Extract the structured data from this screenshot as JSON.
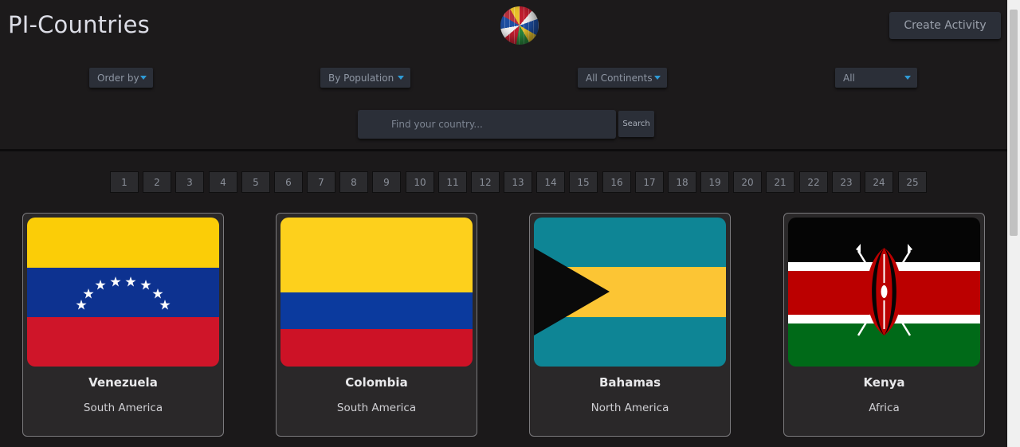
{
  "header": {
    "title": "PI-Countries",
    "create_button": "Create Activity"
  },
  "filters": {
    "order_by": "Order by",
    "population": "By Population",
    "continents": "All Continents",
    "activities": "All"
  },
  "search": {
    "placeholder": "Find your country...",
    "button": "Search"
  },
  "pagination": [
    "1",
    "2",
    "3",
    "4",
    "5",
    "6",
    "7",
    "8",
    "9",
    "10",
    "11",
    "12",
    "13",
    "14",
    "15",
    "16",
    "17",
    "18",
    "19",
    "20",
    "21",
    "22",
    "23",
    "24",
    "25"
  ],
  "countries": [
    {
      "name": "Venezuela",
      "continent": "South America",
      "flag": "venezuela-flag-icon"
    },
    {
      "name": "Colombia",
      "continent": "South America",
      "flag": "colombia-flag-icon"
    },
    {
      "name": "Bahamas",
      "continent": "North America",
      "flag": "bahamas-flag-icon"
    },
    {
      "name": "Kenya",
      "continent": "Africa",
      "flag": "kenya-flag-icon"
    }
  ],
  "colors": {
    "background": "#1b191a",
    "control": "#2b2f38",
    "caret": "#2f9bd6"
  }
}
